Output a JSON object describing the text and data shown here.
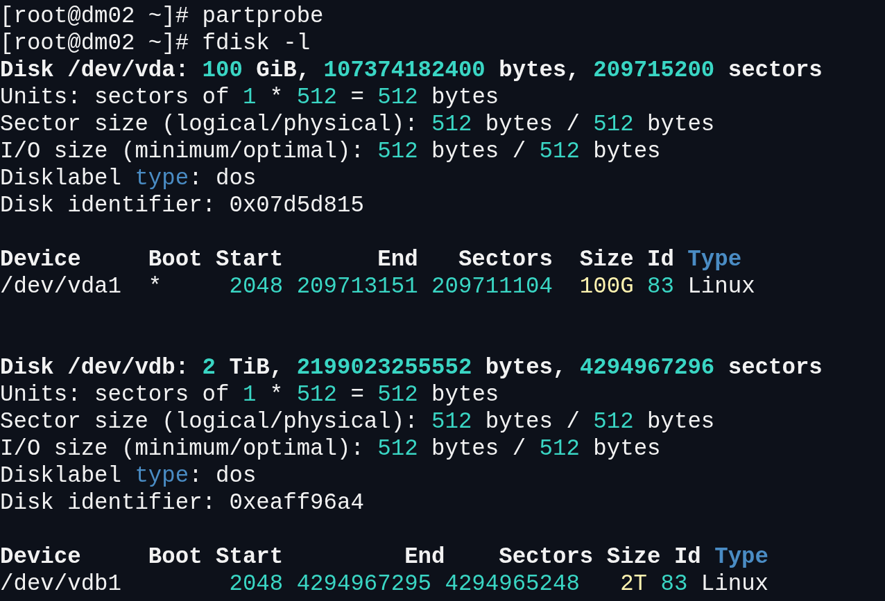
{
  "terminal": {
    "lines": [
      {
        "kind": "command",
        "bold": false,
        "segments": [
          {
            "kind": "text",
            "text": "[root@dm02 ~]# partprobe"
          }
        ]
      },
      {
        "kind": "command",
        "bold": false,
        "segments": [
          {
            "kind": "text",
            "text": "[root@dm02 ~]# fdisk -l"
          }
        ]
      },
      {
        "kind": "output",
        "bold": true,
        "segments": [
          {
            "kind": "text",
            "text": "Disk /dev/vda: "
          },
          {
            "kind": "number",
            "text": "100"
          },
          {
            "kind": "text",
            "text": " GiB, "
          },
          {
            "kind": "number",
            "text": "107374182400"
          },
          {
            "kind": "text",
            "text": " bytes, "
          },
          {
            "kind": "number",
            "text": "209715200"
          },
          {
            "kind": "text",
            "text": " sectors"
          }
        ]
      },
      {
        "kind": "output",
        "bold": false,
        "segments": [
          {
            "kind": "text",
            "text": "Units: sectors of "
          },
          {
            "kind": "number",
            "text": "1"
          },
          {
            "kind": "text",
            "text": " * "
          },
          {
            "kind": "number",
            "text": "512"
          },
          {
            "kind": "text",
            "text": " = "
          },
          {
            "kind": "number",
            "text": "512"
          },
          {
            "kind": "text",
            "text": " bytes"
          }
        ]
      },
      {
        "kind": "output",
        "bold": false,
        "segments": [
          {
            "kind": "text",
            "text": "Sector size (logical/physical): "
          },
          {
            "kind": "number",
            "text": "512"
          },
          {
            "kind": "text",
            "text": " bytes / "
          },
          {
            "kind": "number",
            "text": "512"
          },
          {
            "kind": "text",
            "text": " bytes"
          }
        ]
      },
      {
        "kind": "output",
        "bold": false,
        "segments": [
          {
            "kind": "text",
            "text": "I/O size (minimum/optimal): "
          },
          {
            "kind": "number",
            "text": "512"
          },
          {
            "kind": "text",
            "text": " bytes / "
          },
          {
            "kind": "number",
            "text": "512"
          },
          {
            "kind": "text",
            "text": " bytes"
          }
        ]
      },
      {
        "kind": "output",
        "bold": false,
        "segments": [
          {
            "kind": "text",
            "text": "Disklabel "
          },
          {
            "kind": "keyword",
            "text": "type"
          },
          {
            "kind": "text",
            "text": ": dos"
          }
        ]
      },
      {
        "kind": "output",
        "bold": false,
        "segments": [
          {
            "kind": "text",
            "text": "Disk identifier: 0x07d5d815"
          }
        ]
      },
      {
        "kind": "blank"
      },
      {
        "kind": "output",
        "bold": true,
        "segments": [
          {
            "kind": "text",
            "text": "Device     Boot Start       End   Sectors  Size Id "
          },
          {
            "kind": "keyword",
            "text": "Type"
          }
        ]
      },
      {
        "kind": "output",
        "bold": false,
        "segments": [
          {
            "kind": "text",
            "text": "/dev/vda1  *     "
          },
          {
            "kind": "number",
            "text": "2048 209713151 209711104"
          },
          {
            "kind": "size",
            "text": "  100G"
          },
          {
            "kind": "number",
            "text": " 83"
          },
          {
            "kind": "text",
            "text": " Linux"
          }
        ]
      },
      {
        "kind": "blank"
      },
      {
        "kind": "blank"
      },
      {
        "kind": "output",
        "bold": true,
        "segments": [
          {
            "kind": "text",
            "text": "Disk /dev/vdb: "
          },
          {
            "kind": "number",
            "text": "2"
          },
          {
            "kind": "text",
            "text": " TiB, "
          },
          {
            "kind": "number",
            "text": "2199023255552"
          },
          {
            "kind": "text",
            "text": " bytes, "
          },
          {
            "kind": "number",
            "text": "4294967296"
          },
          {
            "kind": "text",
            "text": " sectors"
          }
        ]
      },
      {
        "kind": "output",
        "bold": false,
        "segments": [
          {
            "kind": "text",
            "text": "Units: sectors of "
          },
          {
            "kind": "number",
            "text": "1"
          },
          {
            "kind": "text",
            "text": " * "
          },
          {
            "kind": "number",
            "text": "512"
          },
          {
            "kind": "text",
            "text": " = "
          },
          {
            "kind": "number",
            "text": "512"
          },
          {
            "kind": "text",
            "text": " bytes"
          }
        ]
      },
      {
        "kind": "output",
        "bold": false,
        "segments": [
          {
            "kind": "text",
            "text": "Sector size (logical/physical): "
          },
          {
            "kind": "number",
            "text": "512"
          },
          {
            "kind": "text",
            "text": " bytes / "
          },
          {
            "kind": "number",
            "text": "512"
          },
          {
            "kind": "text",
            "text": " bytes"
          }
        ]
      },
      {
        "kind": "output",
        "bold": false,
        "segments": [
          {
            "kind": "text",
            "text": "I/O size (minimum/optimal): "
          },
          {
            "kind": "number",
            "text": "512"
          },
          {
            "kind": "text",
            "text": " bytes / "
          },
          {
            "kind": "number",
            "text": "512"
          },
          {
            "kind": "text",
            "text": " bytes"
          }
        ]
      },
      {
        "kind": "output",
        "bold": false,
        "segments": [
          {
            "kind": "text",
            "text": "Disklabel "
          },
          {
            "kind": "keyword",
            "text": "type"
          },
          {
            "kind": "text",
            "text": ": dos"
          }
        ]
      },
      {
        "kind": "output",
        "bold": false,
        "segments": [
          {
            "kind": "text",
            "text": "Disk identifier: 0xeaff96a4"
          }
        ]
      },
      {
        "kind": "blank"
      },
      {
        "kind": "output",
        "bold": true,
        "segments": [
          {
            "kind": "text",
            "text": "Device     Boot Start         End    Sectors Size Id "
          },
          {
            "kind": "keyword",
            "text": "Type"
          }
        ]
      },
      {
        "kind": "output",
        "bold": false,
        "segments": [
          {
            "kind": "text",
            "text": "/dev/vdb1        "
          },
          {
            "kind": "number",
            "text": "2048 4294967295 4294965248"
          },
          {
            "kind": "size",
            "text": "   2T"
          },
          {
            "kind": "number",
            "text": " 83"
          },
          {
            "kind": "text",
            "text": " Linux"
          }
        ]
      }
    ]
  }
}
